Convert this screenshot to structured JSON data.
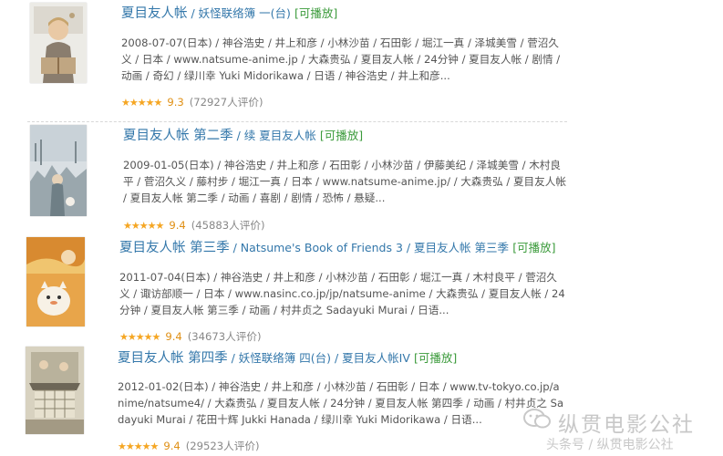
{
  "items": [
    {
      "title": "夏目友人帐",
      "sep": " / ",
      "alt_title": "妖怪联络簿 一(台)",
      "playable": "[可播放]",
      "description": "2008-07-07(日本) / 神谷浩史 / 井上和彦 / 小林沙苗 / 石田彰 / 堀江一真 / 泽城美雪 / 菅沼久义 / 日本 / www.natsume-anime.jp / 大森贵弘 / 夏目友人帐 / 24分钟 / 夏目友人帐 / 剧情 / 动画 / 奇幻 / 绿川幸 Yuki Midorikawa / 日语 / 神谷浩史 / 井上和彦...",
      "stars": "★★★★★",
      "score": "9.3",
      "votes": "(72927人评价)"
    },
    {
      "title": "夏目友人帐 第二季",
      "sep": " / ",
      "alt_title": "续 夏目友人帐",
      "playable": "[可播放]",
      "description": "2009-01-05(日本) / 神谷浩史 / 井上和彦 / 石田彰 / 小林沙苗 / 伊藤美纪 / 泽城美雪 / 木村良平 / 菅沼久义 / 藤村步 / 堀江一真 / 日本 / www.natsume-anime.jp/ / 大森贵弘 / 夏目友人帐 / 夏目友人帐 第二季 / 动画 / 喜剧 / 剧情 / 恐怖 / 悬疑...",
      "stars": "★★★★★",
      "score": "9.4",
      "votes": "(45883人评价)"
    },
    {
      "title": "夏目友人帐 第三季",
      "sep": " / ",
      "alt_title": "Natsume's Book of Friends 3 / 夏目友人帐 第三季",
      "playable": "[可播放]",
      "description": "2011-07-04(日本) / 神谷浩史 / 井上和彦 / 小林沙苗 / 石田彰 / 堀江一真 / 木村良平 / 菅沼久义 / 诹访部顺一 / 日本 / www.nasinc.co.jp/jp/natsume-anime / 大森贵弘 / 夏目友人帐 / 24分钟 / 夏目友人帐 第三季 / 动画 / 村井贞之 Sadayuki Murai / 日语...",
      "stars": "★★★★★",
      "score": "9.4",
      "votes": "(34673人评价)"
    },
    {
      "title": "夏目友人帐 第四季",
      "sep": " / ",
      "alt_title": "妖怪联络簿 四(台) / 夏目友人帐IV",
      "playable": "[可播放]",
      "description": "2012-01-02(日本) / 神谷浩史 / 井上和彦 / 小林沙苗 / 石田彰 / 日本 / www.tv-tokyo.co.jp/anime/natsume4/ / 大森贵弘 / 夏目友人帐 / 24分钟 / 夏目友人帐 第四季 / 动画 / 村井贞之 Sadayuki Murai / 花田十辉 Jukki Hanada / 绿川幸 Yuki Midorikawa / 日语...",
      "stars": "★★★★★",
      "score": "9.4",
      "votes": "(29523人评价)"
    }
  ],
  "watermark": {
    "line1": "纵贯电影公社",
    "line2": "头条号 / 纵贯电影公社"
  },
  "colors": {
    "title_link": "#3377aa",
    "playable": "#3a9a3a",
    "stars": "#f5a623",
    "score": "#e09015",
    "votes": "#888888"
  },
  "icons": [
    "poster-image",
    "star-icon",
    "wechat-logo-icon"
  ]
}
